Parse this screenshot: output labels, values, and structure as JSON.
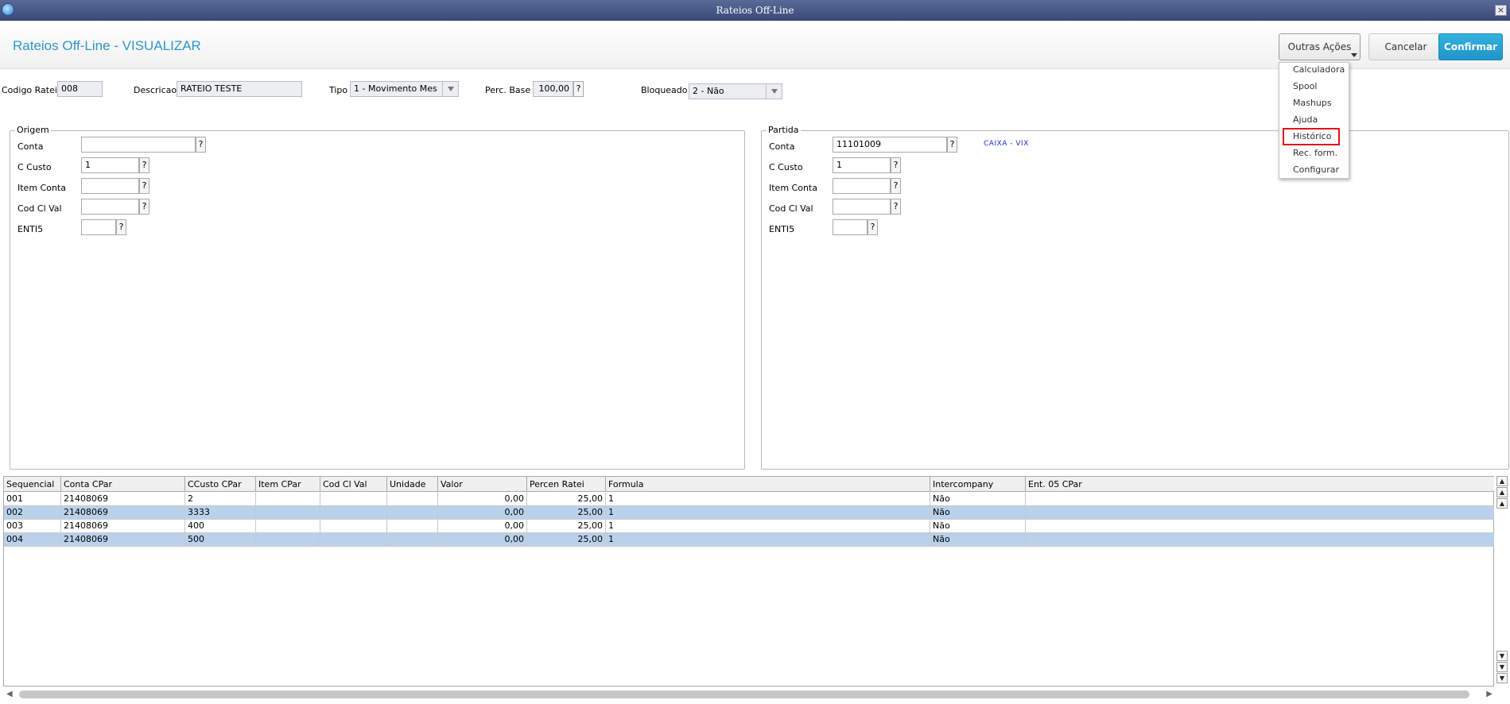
{
  "window": {
    "title": "Rateios Off-Line",
    "close_glyph": "×"
  },
  "header": {
    "title": "Rateios Off-Line - VISUALIZAR",
    "outras_label": "Outras Ações",
    "cancel_label": "Cancelar",
    "confirm_label": "Confirmar"
  },
  "menu": {
    "items": [
      "Calculadora",
      "Spool",
      "Mashups",
      "Ajuda",
      "Histórico",
      "Rec. form.",
      "Configurar"
    ]
  },
  "form": {
    "codigo_label": "Codigo Rateio",
    "codigo_value": "008",
    "descricao_label": "Descricao",
    "descricao_value": "RATEIO TESTE",
    "tipo_label": "Tipo",
    "tipo_value": "1 - Movimento Mes",
    "perc_label": "Perc. Base",
    "perc_value": "100,00",
    "bloqueado_label": "Bloqueado",
    "bloqueado_value": "2 - Não",
    "q": "?"
  },
  "origem": {
    "title": "Origem",
    "conta_label": "Conta",
    "conta_value": "",
    "ccusto_label": "C Custo",
    "ccusto_value": "1",
    "item_label": "Item Conta",
    "item_value": "",
    "codcl_label": "Cod Cl Val",
    "codcl_value": "",
    "enti_label": "ENTI5",
    "enti_value": ""
  },
  "partida": {
    "title": "Partida",
    "conta_label": "Conta",
    "conta_value": "11101009",
    "conta_desc": "CAIXA - VIX",
    "ccusto_label": "C Custo",
    "ccusto_value": "1",
    "item_label": "Item Conta",
    "item_value": "",
    "codcl_label": "Cod Cl Val",
    "codcl_value": "",
    "enti_label": "ENTI5",
    "enti_value": ""
  },
  "grid": {
    "columns": [
      "Sequencial",
      "Conta CPar",
      "CCusto CPar",
      "Item CPar",
      "Cod Cl Val",
      "Unidade",
      "Valor",
      "Percen Ratei",
      "Formula",
      "Intercompany",
      "Ent. 05 CPar"
    ],
    "rows": [
      [
        "001",
        "21408069",
        "2",
        "",
        "",
        "",
        "0,00",
        "25,00",
        "1",
        "Não",
        ""
      ],
      [
        "002",
        "21408069",
        "3333",
        "",
        "",
        "",
        "0,00",
        "25,00",
        "1",
        "Não",
        ""
      ],
      [
        "003",
        "21408069",
        "400",
        "",
        "",
        "",
        "0,00",
        "25,00",
        "1",
        "Não",
        ""
      ],
      [
        "004",
        "21408069",
        "500",
        "",
        "",
        "",
        "0,00",
        "25,00",
        "1",
        "Não",
        ""
      ]
    ]
  },
  "icons": {
    "app": "app-logo-icon",
    "scroll_top": "▲",
    "scroll_page_up": "▲",
    "scroll_up": "▲",
    "scroll_down": "▼",
    "scroll_page_down": "▼",
    "scroll_bottom": "▼",
    "scroll_left": "◀",
    "scroll_right": "▶"
  },
  "colors": {
    "title_bar": "#3b4a79",
    "accent": "#2f95c7",
    "confirm": "#1e95c9",
    "row_alt": "#b9d1ea",
    "highlight": "#e0111a"
  }
}
